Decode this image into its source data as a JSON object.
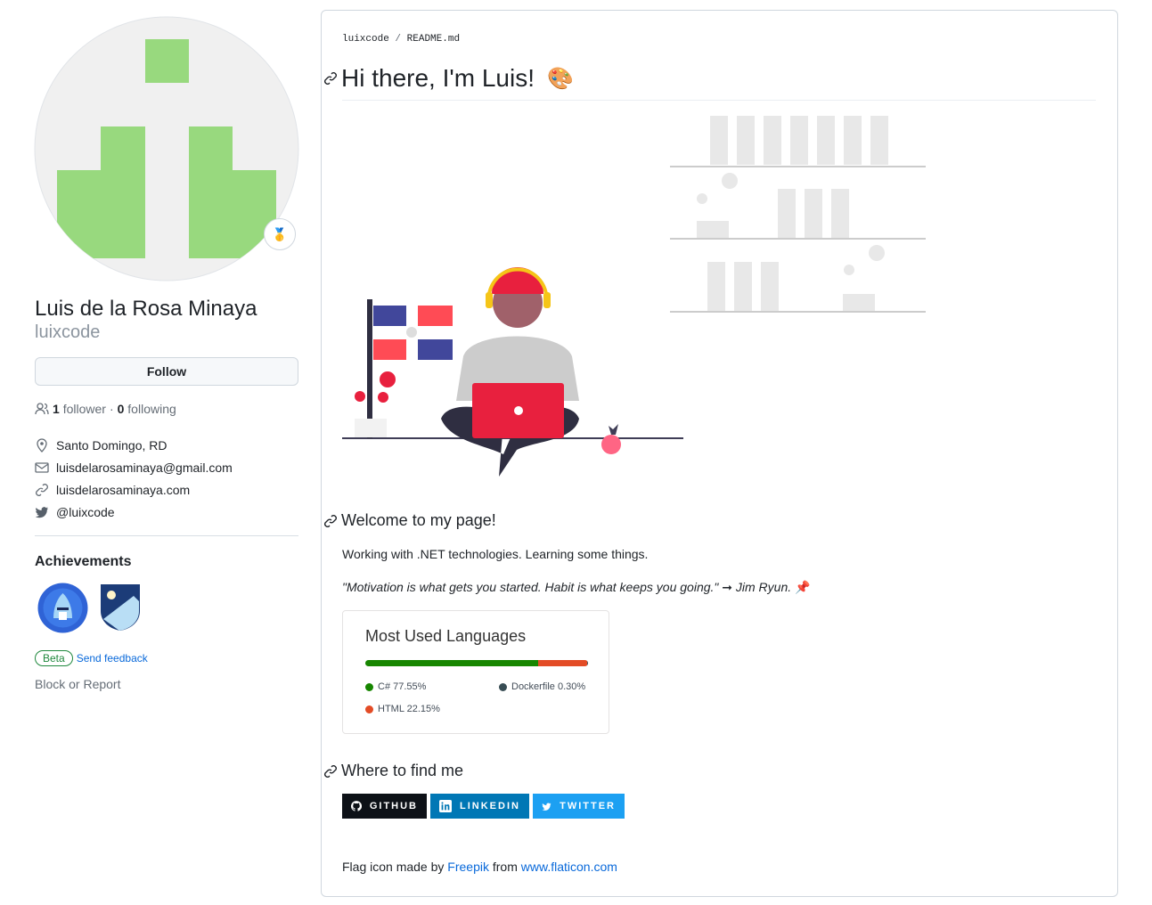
{
  "profile": {
    "name": "Luis de la Rosa Minaya",
    "login": "luixcode",
    "follow_label": "Follow",
    "followers_count": "1",
    "followers_label": "follower",
    "sep": "·",
    "following_count": "0",
    "following_label": "following",
    "badge_icon": "medal-icon",
    "avatar_color": "#98d97e",
    "details": [
      {
        "icon": "location-icon",
        "text": "Santo Domingo, RD"
      },
      {
        "icon": "mail-icon",
        "text": "luisdelarosaminaya@gmail.com"
      },
      {
        "icon": "link-icon",
        "text": "luisdelarosaminaya.com"
      },
      {
        "icon": "twitter-icon",
        "text": "@luixcode"
      }
    ],
    "achievements_title": "Achievements",
    "beta_label": "Beta",
    "feedback_label": "Send feedback",
    "block_label": "Block or Report"
  },
  "readme": {
    "breadcrumb_user": "luixcode",
    "breadcrumb_sep": "/",
    "breadcrumb_file": "README.md",
    "title": "Hi there, I'm Luis!",
    "title_emoji": "🎨",
    "welcome_heading": "Welcome to my page!",
    "intro": "Working with .NET technologies. Learning some things.",
    "quote": "\"Motivation is what gets you started. Habit is what keeps you going.\" ➞ Jim Ryun.",
    "quote_emoji": "📌",
    "languages": {
      "title": "Most Used Languages",
      "items": [
        {
          "name": "C#",
          "percent": 77.55,
          "label": "C# 77.55%",
          "color": "#178600"
        },
        {
          "name": "Dockerfile",
          "percent": 0.3,
          "label": "Dockerfile 0.30%",
          "color": "#384d54"
        },
        {
          "name": "HTML",
          "percent": 22.15,
          "label": "HTML 22.15%",
          "color": "#e34c26"
        }
      ]
    },
    "find_heading": "Where to find me",
    "socials": [
      {
        "label": "GITHUB",
        "color": "#0d1117",
        "icon": "github-icon"
      },
      {
        "label": "LINKEDIN",
        "color": "#0077b5",
        "icon": "linkedin-icon"
      },
      {
        "label": "TWITTER",
        "color": "#1ca0f2",
        "icon": "twitter-icon"
      }
    ],
    "credit_prefix": "Flag icon made by",
    "credit_author": "Freepik",
    "credit_mid": "from",
    "credit_site": "www.flaticon.com"
  }
}
